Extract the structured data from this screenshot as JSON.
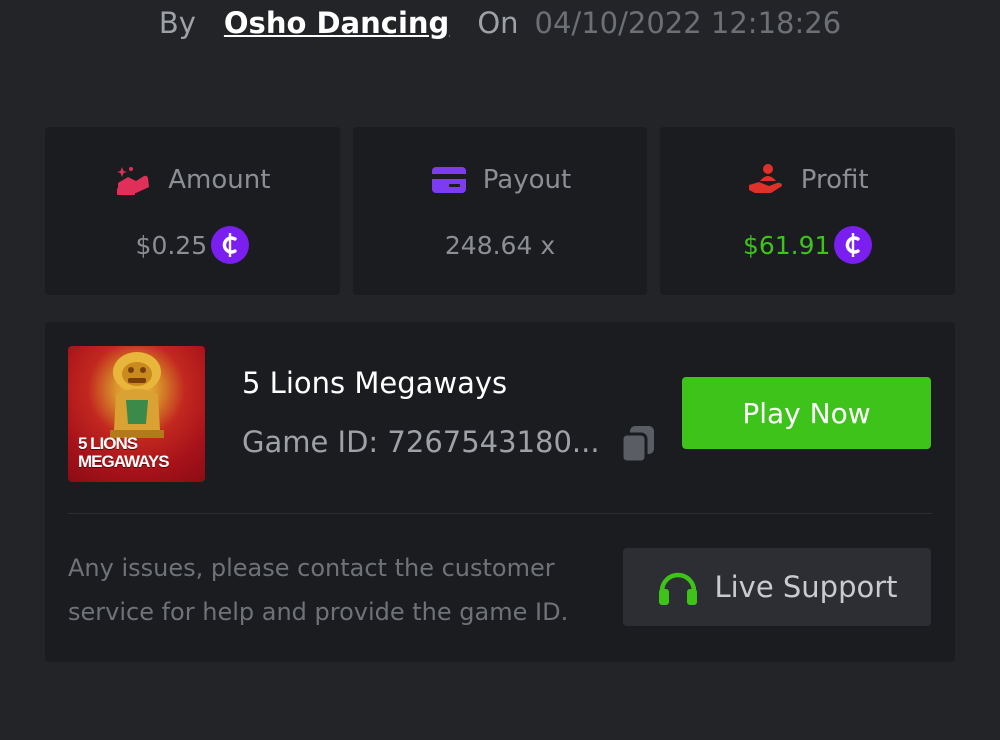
{
  "byline": {
    "by_label": "By",
    "author": "Osho Dancing",
    "on_label": "On",
    "datetime": "04/10/2022 12:18:26"
  },
  "stats": {
    "amount": {
      "label": "Amount",
      "value": "$0.25",
      "icon": "hand-coins-icon",
      "icon_color": "#e0305a"
    },
    "payout": {
      "label": "Payout",
      "value": "248.64 x",
      "icon": "card-icon",
      "icon_color": "#7d3cf2"
    },
    "profit": {
      "label": "Profit",
      "value": "$61.91",
      "icon": "hand-person-icon",
      "icon_color": "#e0302a",
      "value_color": "#3dc41a"
    },
    "coin_symbol": "₵",
    "coin_color": "#7a1ff0"
  },
  "game": {
    "title": "5 Lions Megaways",
    "thumb_text_1": "5 LIONS",
    "thumb_text_2": "MEGAWAYS",
    "id_label": "Game ID: 7267543180...",
    "play_label": "Play Now",
    "note": "Any issues, please contact the customer service for help and provide the game ID.",
    "support_label": "Live Support"
  },
  "colors": {
    "background": "#232428",
    "card": "#1b1c1f",
    "accent_green": "#3ec31b"
  }
}
